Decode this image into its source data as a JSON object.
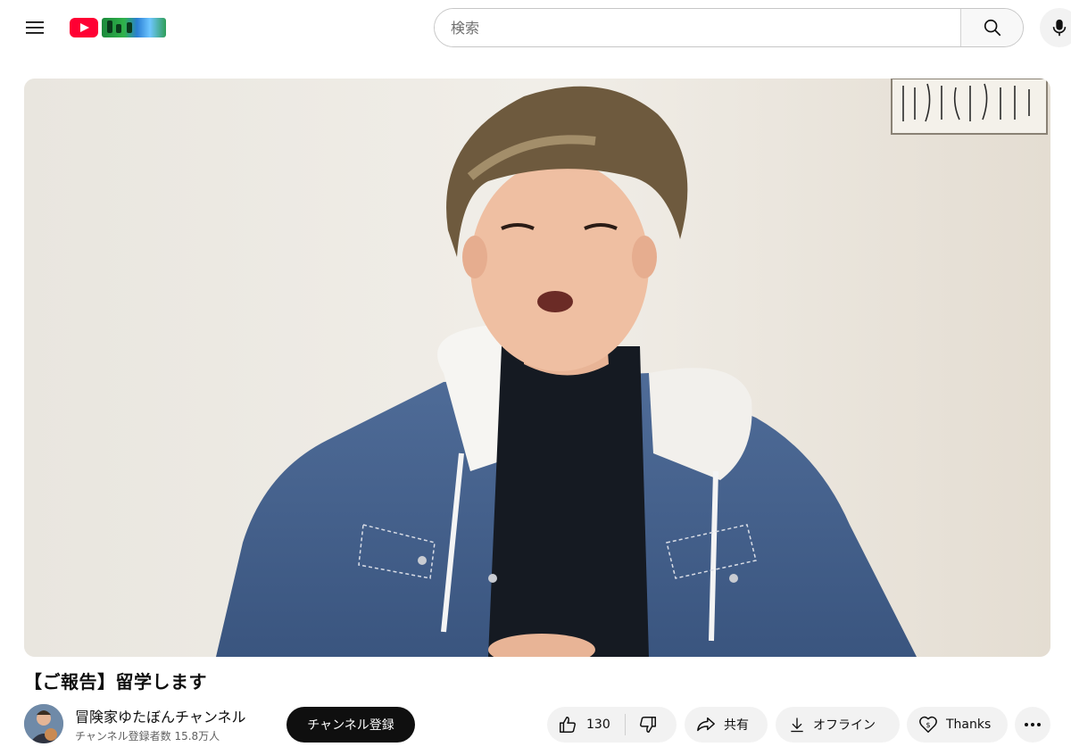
{
  "header": {
    "search_placeholder": "検索",
    "icons": {
      "menu": "hamburger-icon",
      "search": "search-icon",
      "mic": "microphone-icon"
    },
    "brand_color": "#ff0033"
  },
  "video": {
    "title": "【ご報告】留学します"
  },
  "channel": {
    "name": "冒険家ゆたぼんチャンネル",
    "subscribers": "チャンネル登録者数 15.8万人",
    "subscribe_label": "チャンネル登録"
  },
  "actions": {
    "like_count": "130",
    "share_label": "共有",
    "download_label": "オフライン",
    "thanks_label": "Thanks"
  }
}
